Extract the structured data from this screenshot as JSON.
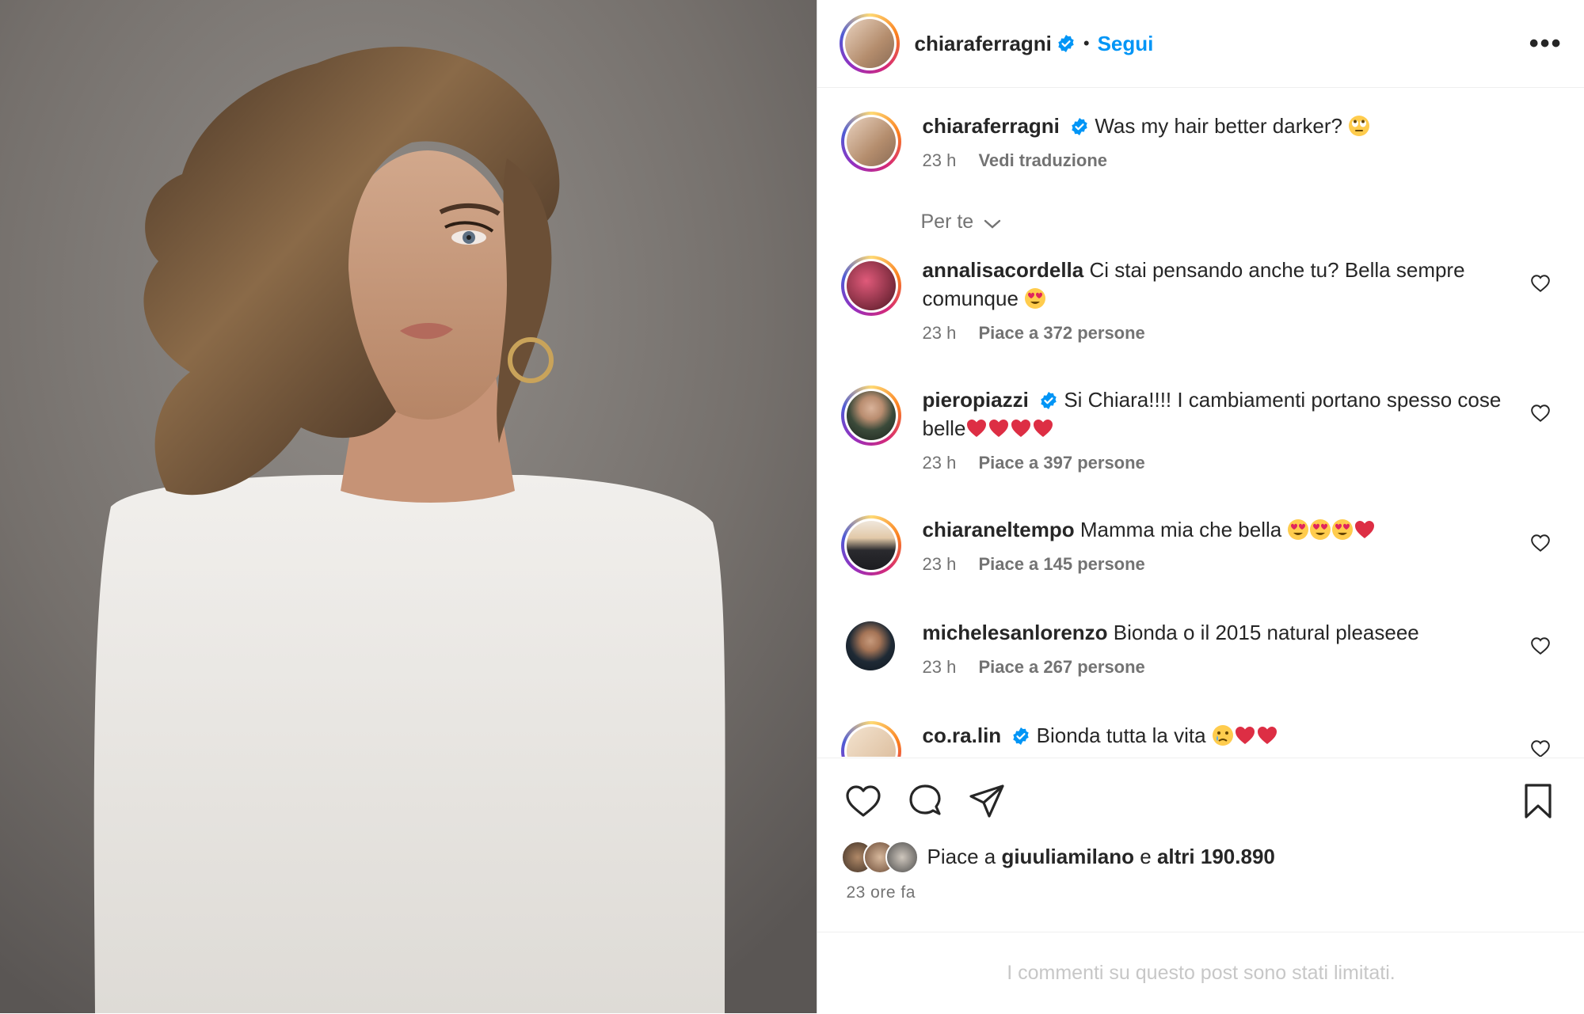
{
  "post": {
    "author": "chiaraferragni",
    "follow_label": "Segui",
    "dot": "•",
    "more": "•••"
  },
  "caption": {
    "username": "chiaraferragni",
    "text": "Was my hair better darker?",
    "time": "23 h",
    "translate": "Vedi traduzione"
  },
  "filter_label": "Per te",
  "comments": [
    {
      "username": "annalisacordella",
      "text_line1": "Ci stai pensando anche tu? Bella sempre",
      "text_line2": "comunque",
      "time": "23 h",
      "likes": "Piace a 372 persone"
    },
    {
      "username": "pieropiazzi",
      "text_line1": "Si Chiara!!!! I cambiamenti portano spesso cose",
      "text_line2": "belle",
      "time": "23 h",
      "likes": "Piace a 397 persone"
    },
    {
      "username": "chiaraneltempo",
      "text_line1": "Mamma mia che bella",
      "time": "23 h",
      "likes": "Piace a 145 persone"
    },
    {
      "username": "michelesanlorenzo",
      "text_line1": "Bionda o il 2015 natural pleaseee",
      "time": "23 h",
      "likes": "Piace a 267 persone"
    },
    {
      "username": "co.ra.lin",
      "text_line1": "Bionda tutta la vita"
    }
  ],
  "likes_summary": {
    "prefix": "Piace a",
    "user": "giuuliamilano",
    "conj": "e",
    "others": "altri 190.890"
  },
  "time_ago": "23 ore fa",
  "limited_notice": "I commenti su questo post sono stati limitati.",
  "colors": {
    "accent": "#0095f6",
    "verified": "#0095f6",
    "heart": "#e0245e"
  }
}
